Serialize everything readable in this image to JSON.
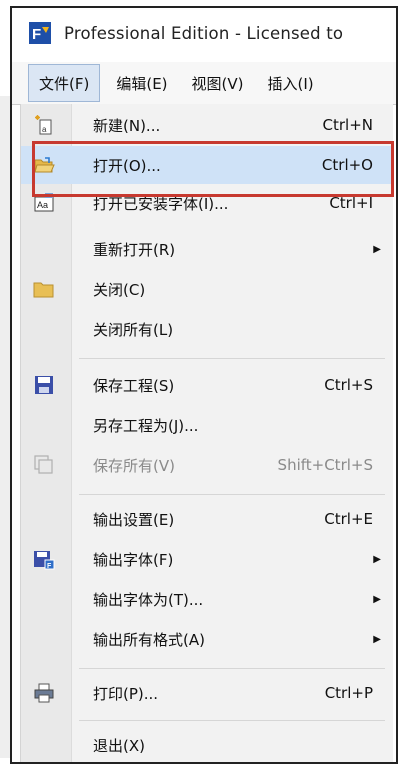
{
  "window": {
    "title": "Professional Edition - Licensed to"
  },
  "menubar": {
    "items": [
      {
        "label": "文件(F)",
        "active": true
      },
      {
        "label": "编辑(E)"
      },
      {
        "label": "视图(V)"
      },
      {
        "label": "插入(I)"
      }
    ]
  },
  "file_menu": {
    "items": [
      {
        "label": "新建(N)...",
        "shortcut": "Ctrl+N",
        "icon": "new-file-icon"
      },
      {
        "label": "打开(O)...",
        "shortcut": "Ctrl+O",
        "icon": "open-folder-icon",
        "highlighted": true
      },
      {
        "label": "打开已安装字体(I)...",
        "shortcut": "Ctrl+I",
        "icon": "installed-font-icon"
      },
      {
        "label": "重新打开(R)",
        "submenu": true
      },
      {
        "label": "关闭(C)",
        "icon": "close-folder-icon"
      },
      {
        "label": "关闭所有(L)"
      },
      {
        "label": "保存工程(S)",
        "shortcut": "Ctrl+S",
        "icon": "save-icon"
      },
      {
        "label": "另存工程为(J)..."
      },
      {
        "label": "保存所有(V)",
        "shortcut": "Shift+Ctrl+S",
        "icon": "save-all-icon",
        "disabled": true
      },
      {
        "label": "输出设置(E)",
        "shortcut": "Ctrl+E"
      },
      {
        "label": "输出字体(F)",
        "icon": "export-font-icon",
        "submenu": true
      },
      {
        "label": "输出字体为(T)...",
        "submenu": true
      },
      {
        "label": "输出所有格式(A)",
        "submenu": true
      },
      {
        "label": "打印(P)...",
        "shortcut": "Ctrl+P",
        "icon": "printer-icon"
      },
      {
        "label": "退出(X)"
      }
    ]
  },
  "colors": {
    "highlight": "#cfe2f7",
    "annotation": "#c7392f",
    "menu_bg": "#f2f2f2"
  }
}
